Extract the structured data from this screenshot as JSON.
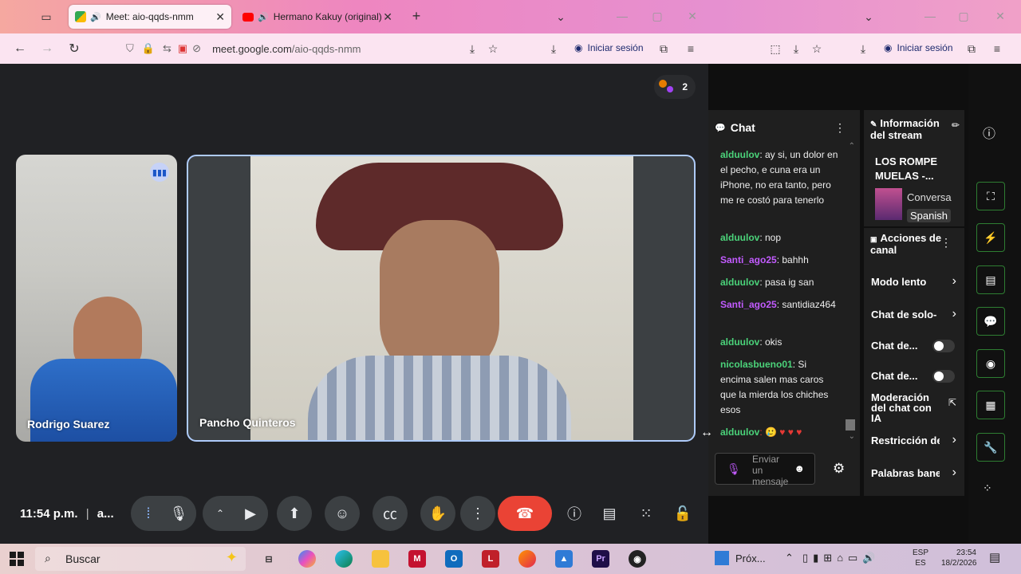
{
  "browser": {
    "tabs": [
      {
        "title": "Meet: aio-qqds-nmm"
      },
      {
        "title": "Hermano Kakuy (original) -"
      }
    ],
    "url_host": "meet.google.com",
    "url_path": "/aio-qqds-nmm",
    "signin_label": "Iniciar sesión",
    "signin_label_2": "Iniciar sesión"
  },
  "meet": {
    "participant_count": "2",
    "tiles": [
      {
        "name": "Rodrigo Suarez"
      },
      {
        "name": "Pancho Quinteros"
      }
    ],
    "time": "11:54 p.m.",
    "separator": "|",
    "meeting_code": "a..."
  },
  "chat": {
    "title": "Chat",
    "messages": [
      {
        "user": "alduulov",
        "text": ": ay si, un dolor en el pecho, e cuna era un iPhone, no era tanto, pero me re costó para tenerlo",
        "color": "#4bd37a"
      },
      {
        "user": "alduulov",
        "text": ": nop",
        "color": "#4bd37a"
      },
      {
        "user": "Santi_ago25",
        "text": ": bahhh",
        "color": "#c25bff"
      },
      {
        "user": "alduulov",
        "text": ": pasa ig san",
        "color": "#4bd37a"
      },
      {
        "user": "Santi_ago25",
        "text": ": santidiaz464",
        "color": "#c25bff"
      },
      {
        "user": "alduulov",
        "text": ": okis",
        "color": "#4bd37a"
      },
      {
        "user": "nicolasbueno01",
        "text": ": Si encima salen mas caros que la mierda los chiches esos",
        "color": "#4bd37a"
      },
      {
        "user": "alduulov",
        "text": ": 🥲 ♥ ♥ ♥",
        "color": "#4bd37a"
      }
    ],
    "input_placeholder": "Enviar un mensaje"
  },
  "stream_info": {
    "title": "Información del stream",
    "stream_name": "LOS ROMPE MUELAS -...",
    "category": "Conversa",
    "language": "Spanish"
  },
  "channel_actions": {
    "title": "Acciones de canal",
    "items": [
      {
        "label": "Modo lento"
      },
      {
        "label": "Chat de solo-"
      },
      {
        "label": "Chat de..."
      },
      {
        "label": "Chat de..."
      },
      {
        "label": "Moderación del chat con IA"
      },
      {
        "label": "Restricción de"
      },
      {
        "label": "Palabras bane"
      }
    ]
  },
  "taskbar": {
    "search_placeholder": "Buscar",
    "app_label": "Próx...",
    "lang_top": "ESP",
    "lang_bottom": "ES",
    "time": "23:54",
    "date": "18/2/2026"
  }
}
